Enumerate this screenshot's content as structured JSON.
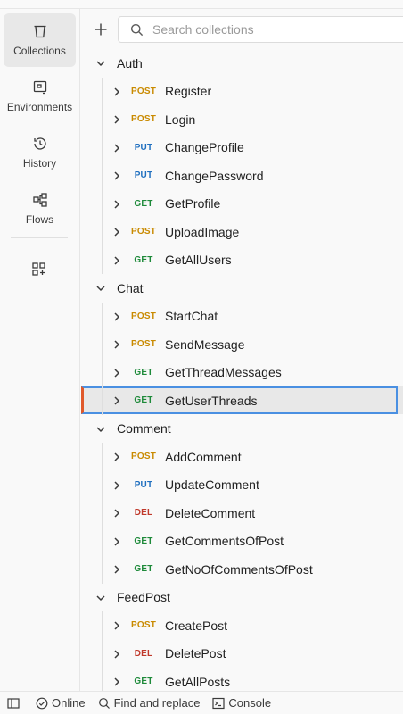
{
  "sidebar": {
    "items": [
      {
        "label": "Collections",
        "icon": "trash-bin-icon"
      },
      {
        "label": "Environments",
        "icon": "environment-icon"
      },
      {
        "label": "History",
        "icon": "history-icon"
      },
      {
        "label": "Flows",
        "icon": "flows-icon"
      }
    ],
    "more_icon": "add-widget-icon"
  },
  "search": {
    "placeholder": "Search collections",
    "value": ""
  },
  "colors": {
    "POST": "#c98a00",
    "PUT": "#1f6fbf",
    "GET": "#1e8a3a",
    "DEL": "#c0392b",
    "selected_border": "#4a90e2",
    "selected_accent": "#e0592b"
  },
  "collections": [
    {
      "name": "Auth",
      "requests": [
        {
          "method": "POST",
          "name": "Register"
        },
        {
          "method": "POST",
          "name": "Login"
        },
        {
          "method": "PUT",
          "name": "ChangeProfile"
        },
        {
          "method": "PUT",
          "name": "ChangePassword"
        },
        {
          "method": "GET",
          "name": "GetProfile"
        },
        {
          "method": "POST",
          "name": "UploadImage"
        },
        {
          "method": "GET",
          "name": "GetAllUsers"
        }
      ]
    },
    {
      "name": "Chat",
      "requests": [
        {
          "method": "POST",
          "name": "StartChat"
        },
        {
          "method": "POST",
          "name": "SendMessage"
        },
        {
          "method": "GET",
          "name": "GetThreadMessages"
        },
        {
          "method": "GET",
          "name": "GetUserThreads",
          "selected": true
        }
      ]
    },
    {
      "name": "Comment",
      "requests": [
        {
          "method": "POST",
          "name": "AddComment"
        },
        {
          "method": "PUT",
          "name": "UpdateComment"
        },
        {
          "method": "DEL",
          "name": "DeleteComment"
        },
        {
          "method": "GET",
          "name": "GetCommentsOfPost"
        },
        {
          "method": "GET",
          "name": "GetNoOfCommentsOfPost"
        }
      ]
    },
    {
      "name": "FeedPost",
      "requests": [
        {
          "method": "POST",
          "name": "CreatePost"
        },
        {
          "method": "DEL",
          "name": "DeletePost"
        },
        {
          "method": "GET",
          "name": "GetAllPosts"
        }
      ]
    }
  ],
  "statusbar": {
    "online": "Online",
    "find_replace": "Find and replace",
    "console": "Console"
  }
}
